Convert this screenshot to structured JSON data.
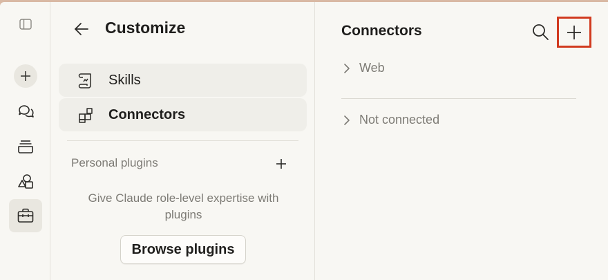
{
  "header": {
    "title": "Customize"
  },
  "rail": {
    "items": [
      {
        "icon": "sidebar-toggle-icon"
      },
      {
        "icon": "plus-icon"
      },
      {
        "icon": "chats-icon"
      },
      {
        "icon": "projects-icon"
      },
      {
        "icon": "shapes-icon"
      },
      {
        "icon": "briefcase-icon",
        "active": true
      }
    ]
  },
  "nav": {
    "items": [
      {
        "label": "Skills",
        "icon": "scroll-icon",
        "active": false
      },
      {
        "label": "Connectors",
        "icon": "blocks-icon",
        "active": true
      }
    ]
  },
  "plugins": {
    "section_label": "Personal plugins",
    "empty_text": "Give Claude role-level expertise with plugins",
    "browse_label": "Browse plugins"
  },
  "connectors": {
    "title": "Connectors",
    "groups": [
      {
        "label": "Web"
      },
      {
        "label": "Not connected"
      }
    ]
  },
  "colors": {
    "highlight": "#d13a1f",
    "background": "#f8f7f3",
    "nav_item_bg": "#efeee9"
  }
}
